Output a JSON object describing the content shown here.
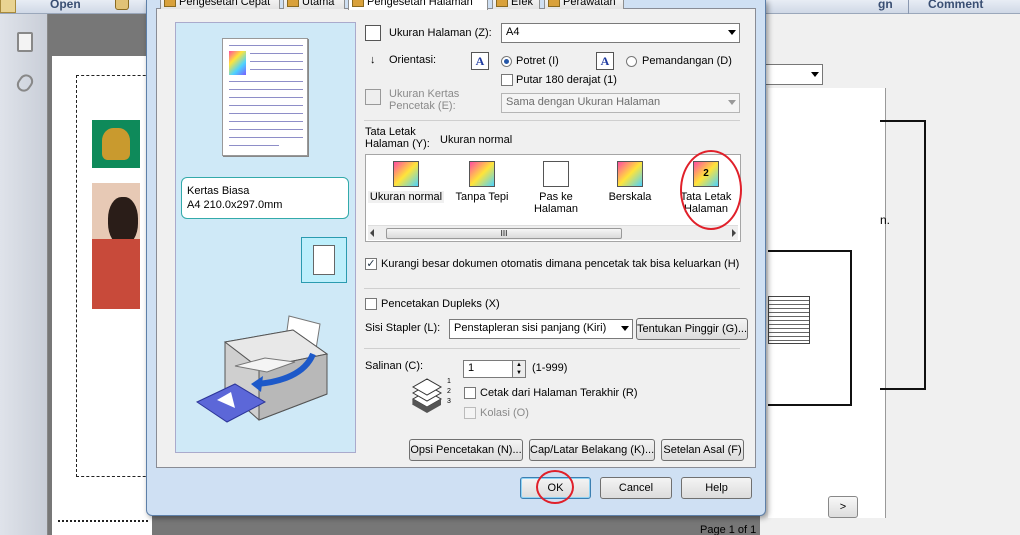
{
  "background": {
    "toolbar": {
      "open": "Open",
      "sign": "gn",
      "comment": "Comment"
    },
    "document": {
      "line1": "n.",
      "page_status": "Page 1 of 1",
      "next": ">"
    }
  },
  "tabs": [
    {
      "label": "Pengesetan Cepat"
    },
    {
      "label": "Utama"
    },
    {
      "label": "Pengesetan Halaman"
    },
    {
      "label": "Efek"
    },
    {
      "label": "Perawatan"
    }
  ],
  "preview": {
    "media_line1": "Kertas Biasa",
    "media_line2": "A4 210.0x297.0mm"
  },
  "page_size": {
    "label": "Ukuran Halaman (Z):",
    "value": "A4"
  },
  "orientation": {
    "label": "Orientasi:",
    "portrait": "Potret (I)",
    "landscape": "Pemandangan (D)",
    "rotate180": "Putar 180 derajat (1)",
    "icon_letter": "A"
  },
  "printer_paper": {
    "label_line1": "Ukuran Kertas",
    "label_line2": "Pencetak (E):",
    "value": "Sama dengan Ukuran Halaman"
  },
  "page_layout": {
    "label_line1": "Tata Letak",
    "label_line2": "Halaman (Y):",
    "current": "Ukuran normal",
    "items": [
      {
        "l1": "Ukuran normal",
        "l2": ""
      },
      {
        "l1": "Tanpa Tepi",
        "l2": ""
      },
      {
        "l1": "Pas ke",
        "l2": "Halaman"
      },
      {
        "l1": "Berskala",
        "l2": ""
      },
      {
        "l1": "Tata Letak",
        "l2": "Halaman"
      }
    ],
    "layout_icon_num": "2",
    "scroll_grip": "III"
  },
  "reduce": {
    "label": "Kurangi besar dokumen otomatis dimana pencetak tak bisa keluarkan (H)",
    "checked": true
  },
  "duplex": {
    "label": "Pencetakan Dupleks (X)",
    "checked": false
  },
  "stapler": {
    "label": "Sisi Stapler (L):",
    "value": "Penstapleran sisi panjang (Kiri)",
    "margin_button": "Tentukan Pinggir (G)..."
  },
  "copies": {
    "label": "Salinan (C):",
    "value": "1",
    "range": "(1-999)",
    "from_last": "Cetak dari Halaman Terakhir (R)",
    "collate": "Kolasi (O)",
    "stack": "1 2 3"
  },
  "bottom_buttons": {
    "options": "Opsi Pencetakan (N)...",
    "stamp": "Cap/Latar Belakang (K)...",
    "defaults": "Setelan Asal (F)"
  },
  "dialog_buttons": {
    "ok": "OK",
    "cancel": "Cancel",
    "help": "Help"
  },
  "colors": {
    "accent": "#2456a8",
    "preview_bg": "#cfe9f7",
    "annotation": "#e0202a"
  }
}
